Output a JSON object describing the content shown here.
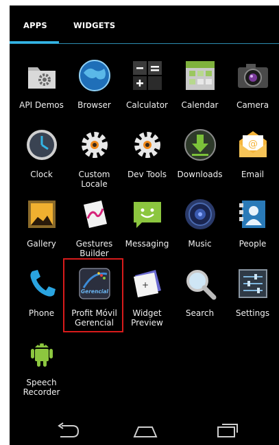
{
  "tabs": {
    "apps": "APPS",
    "widgets": "WIDGETS"
  },
  "apps": [
    {
      "label": "API Demos",
      "icon": "folder-gear-icon"
    },
    {
      "label": "Browser",
      "icon": "globe-icon"
    },
    {
      "label": "Calculator",
      "icon": "calculator-icon"
    },
    {
      "label": "Calendar",
      "icon": "calendar-icon"
    },
    {
      "label": "Camera",
      "icon": "camera-icon"
    },
    {
      "label": "Clock",
      "icon": "clock-icon"
    },
    {
      "label": "Custom\nLocale",
      "icon": "gear-icon"
    },
    {
      "label": "Dev Tools",
      "icon": "gear-icon"
    },
    {
      "label": "Downloads",
      "icon": "download-icon"
    },
    {
      "label": "Email",
      "icon": "envelope-icon"
    },
    {
      "label": "Gallery",
      "icon": "image-icon"
    },
    {
      "label": "Gestures\nBuilder",
      "icon": "gesture-icon"
    },
    {
      "label": "Messaging",
      "icon": "message-icon"
    },
    {
      "label": "Music",
      "icon": "speaker-icon"
    },
    {
      "label": "People",
      "icon": "contacts-icon"
    },
    {
      "label": "Phone",
      "icon": "phone-icon"
    },
    {
      "label": "Profit Móvil\nGerencial",
      "icon": "profit-gerencial-icon",
      "logo_text": "Gerencial"
    },
    {
      "label": "Widget\nPreview",
      "icon": "widget-icon"
    },
    {
      "label": "Search",
      "icon": "search-icon"
    },
    {
      "label": "Settings",
      "icon": "settings-icon"
    },
    {
      "label": "Speech\nRecorder",
      "icon": "android-icon"
    }
  ],
  "navbar": {
    "back": "back-icon",
    "home": "home-icon",
    "recents": "recents-icon"
  },
  "colors": {
    "accent": "#33b5e5",
    "highlight": "#d91b1b",
    "background": "#000000"
  }
}
